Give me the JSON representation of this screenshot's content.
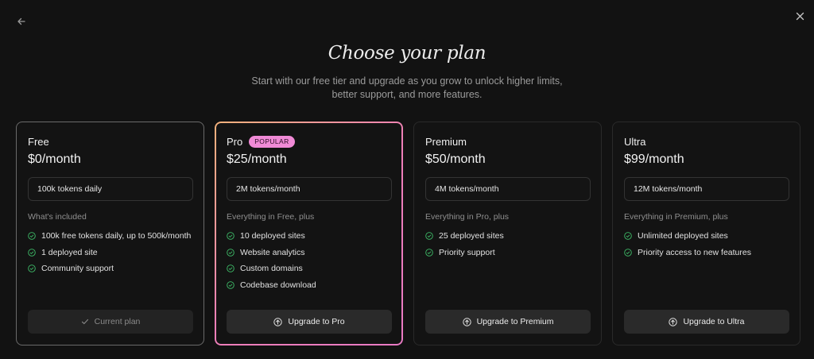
{
  "header": {
    "title": "Choose your plan",
    "subtitle": "Start with our free tier and upgrade as you grow to unlock higher limits, better support, and more features."
  },
  "icons": {
    "back": "arrow-left-icon",
    "close": "close-icon",
    "check": "check-circle-icon",
    "upgrade": "arrow-up-circle-icon"
  },
  "colors": {
    "accent_badge": "#f08ad6",
    "check_green": "#3fbf6a",
    "pro_border_start": "#f4b27a",
    "pro_border_end": "#e97ac4"
  },
  "plans": [
    {
      "name": "Free",
      "price": "$0/month",
      "tokens": "100k tokens daily",
      "included_label": "What's included",
      "features": [
        "100k free tokens daily, up to 500k/month",
        "1 deployed site",
        "Community support"
      ],
      "cta": "Current plan"
    },
    {
      "name": "Pro",
      "badge": "POPULAR",
      "price": "$25/month",
      "tokens": "2M tokens/month",
      "included_label": "Everything in Free, plus",
      "features": [
        "10 deployed sites",
        "Website analytics",
        "Custom domains",
        "Codebase download"
      ],
      "cta": "Upgrade to Pro"
    },
    {
      "name": "Premium",
      "price": "$50/month",
      "tokens": "4M tokens/month",
      "included_label": "Everything in Pro, plus",
      "features": [
        "25 deployed sites",
        "Priority support"
      ],
      "cta": "Upgrade to Premium"
    },
    {
      "name": "Ultra",
      "price": "$99/month",
      "tokens": "12M tokens/month",
      "included_label": "Everything in Premium, plus",
      "features": [
        "Unlimited deployed sites",
        "Priority access to new features"
      ],
      "cta": "Upgrade to Ultra"
    }
  ]
}
